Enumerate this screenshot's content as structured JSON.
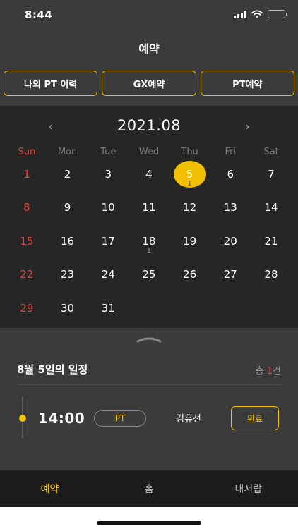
{
  "status_bar": {
    "time": "8:44"
  },
  "header": {
    "title": "예약"
  },
  "tabs": [
    {
      "label": "나의 PT 이력"
    },
    {
      "label": "GX예약"
    },
    {
      "label": "PT예약"
    }
  ],
  "calendar": {
    "month": "2021.08",
    "prev": "‹",
    "next": "›",
    "weekdays": [
      "Sun",
      "Mon",
      "Tue",
      "Wed",
      "Thu",
      "Fri",
      "Sat"
    ],
    "days": [
      {
        "n": "1"
      },
      {
        "n": "2"
      },
      {
        "n": "3"
      },
      {
        "n": "4"
      },
      {
        "n": "5",
        "count": "1",
        "selected": true
      },
      {
        "n": "6"
      },
      {
        "n": "7"
      },
      {
        "n": "8"
      },
      {
        "n": "9"
      },
      {
        "n": "10"
      },
      {
        "n": "11"
      },
      {
        "n": "12"
      },
      {
        "n": "13"
      },
      {
        "n": "14"
      },
      {
        "n": "15"
      },
      {
        "n": "16"
      },
      {
        "n": "17"
      },
      {
        "n": "18",
        "count": "1"
      },
      {
        "n": "19"
      },
      {
        "n": "20"
      },
      {
        "n": "21"
      },
      {
        "n": "22"
      },
      {
        "n": "23"
      },
      {
        "n": "24"
      },
      {
        "n": "25"
      },
      {
        "n": "26"
      },
      {
        "n": "27"
      },
      {
        "n": "28"
      },
      {
        "n": "29"
      },
      {
        "n": "30"
      },
      {
        "n": "31"
      }
    ]
  },
  "schedule": {
    "title": "8월 5일의 일정",
    "total_prefix": "총 ",
    "total_count": "1",
    "total_suffix": "건",
    "item": {
      "time": "14:00",
      "type": "PT",
      "trainer": "김유선",
      "status": "완료"
    }
  },
  "bottom_nav": [
    {
      "label": "예약",
      "active": true
    },
    {
      "label": "홈",
      "active": false
    },
    {
      "label": "내서랍",
      "active": false
    }
  ],
  "colors": {
    "accent": "#f2c000",
    "sunday": "#e5413a",
    "header_bg": "#3b3b3b",
    "calendar_bg": "#262626",
    "nav_bg": "#1c1c1c"
  }
}
